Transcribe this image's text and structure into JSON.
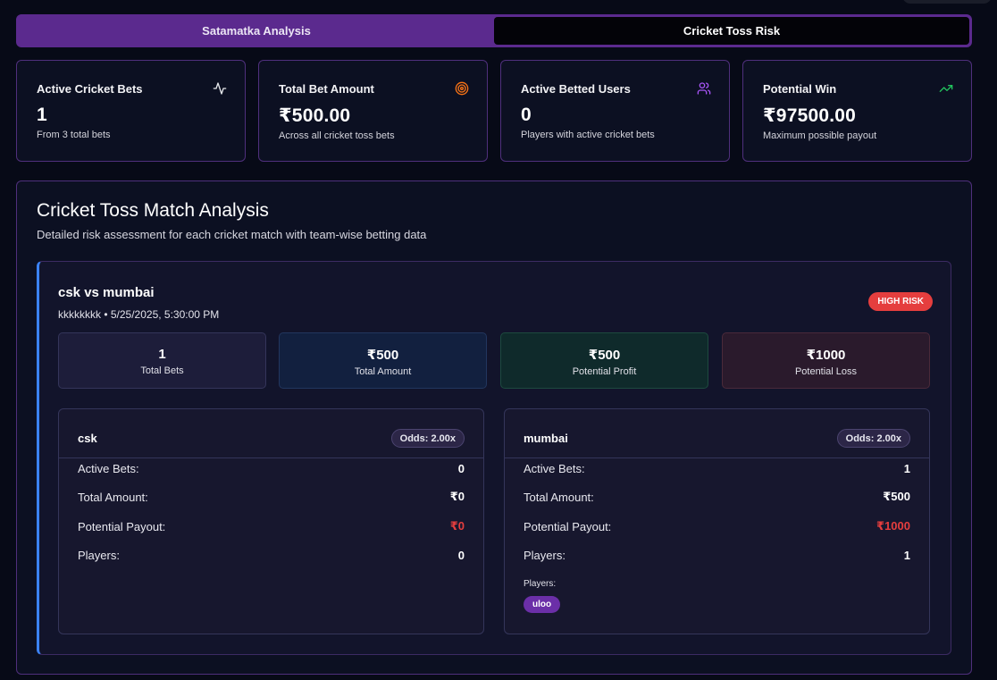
{
  "tabs": [
    {
      "label": "Satamatka Analysis",
      "active": false
    },
    {
      "label": "Cricket Toss Risk",
      "active": true
    }
  ],
  "stats": [
    {
      "title": "Active Cricket Bets",
      "value": "1",
      "sub": "From 3 total bets",
      "icon": "activity-icon",
      "icon_color": "#e5e7eb"
    },
    {
      "title": "Total Bet Amount",
      "value": "₹500.00",
      "sub": "Across all cricket toss bets",
      "icon": "target-icon",
      "icon_color": "#f97316"
    },
    {
      "title": "Active Betted Users",
      "value": "0",
      "sub": "Players with active cricket bets",
      "icon": "users-icon",
      "icon_color": "#a855f7"
    },
    {
      "title": "Potential Win",
      "value": "₹97500.00",
      "sub": "Maximum possible payout",
      "icon": "trending-up-icon",
      "icon_color": "#22c55e"
    }
  ],
  "panel": {
    "title": "Cricket Toss Match Analysis",
    "subtitle": "Detailed risk assessment for each cricket match with team-wise betting data"
  },
  "match": {
    "title": "csk vs mumbai",
    "meta": "kkkkkkkk • 5/25/2025, 5:30:00 PM",
    "risk": "HIGH RISK",
    "summary": [
      {
        "value": "1",
        "label": "Total Bets",
        "bg": "#1d1d3a",
        "border": "#34355a"
      },
      {
        "value": "₹500",
        "label": "Total Amount",
        "bg": "#12203f",
        "border": "#22365e"
      },
      {
        "value": "₹500",
        "label": "Potential Profit",
        "bg": "#0f2a2b",
        "border": "#1d4a3f"
      },
      {
        "value": "₹1000",
        "label": "Potential Loss",
        "bg": "#2a1a2c",
        "border": "#4a2a3a"
      }
    ],
    "teams": [
      {
        "name": "csk",
        "odds": "Odds: 2.00x",
        "rows": [
          {
            "label": "Active Bets:",
            "value": "0"
          },
          {
            "label": "Total Amount:",
            "value": "₹0"
          },
          {
            "label": "Potential Payout:",
            "value": "₹0"
          },
          {
            "label": "Players:",
            "value": "0"
          }
        ],
        "players_label": "",
        "players": []
      },
      {
        "name": "mumbai",
        "odds": "Odds: 2.00x",
        "rows": [
          {
            "label": "Active Bets:",
            "value": "1"
          },
          {
            "label": "Total Amount:",
            "value": "₹500"
          },
          {
            "label": "Potential Payout:",
            "value": "₹1000"
          },
          {
            "label": "Players:",
            "value": "1"
          }
        ],
        "players_label": "Players:",
        "players": [
          "uloo"
        ]
      }
    ]
  }
}
